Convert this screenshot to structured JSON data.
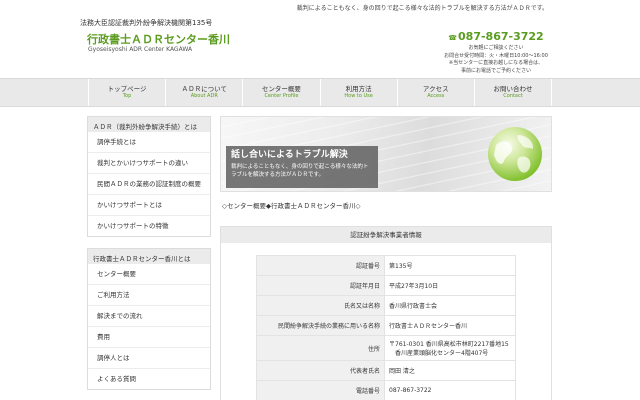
{
  "topbar": {
    "description": "裁判によることもなく、身の回りで起こる様々な法的トラブルを解決する方法がＡＤＲです。"
  },
  "header": {
    "certification": "法務大臣認証裁判外紛争解決機関第135号",
    "site_title": "行政書士ＡＤＲセンター香川",
    "site_subtitle": "Gyoseisyoshi ADR Center KAGAWA",
    "phone": "087-867-3722",
    "phone_icon": "phone-icon",
    "contact_lines": [
      "お気軽にご相談ください",
      "お問合せ受付時間：火・木曜日10:00～16:00",
      "※当センターに直接お越しになる場合は、",
      "事前にお電話でご予約ください"
    ]
  },
  "nav": {
    "items": [
      {
        "label": "トップページ",
        "sub": "Top"
      },
      {
        "label": "ＡＤＲについて",
        "sub": "About ADR"
      },
      {
        "label": "センター概要",
        "sub": "Center Profile"
      },
      {
        "label": "利用方法",
        "sub": "How to Use"
      },
      {
        "label": "アクセス",
        "sub": "Access"
      },
      {
        "label": "お問い合わせ",
        "sub": "Contact"
      }
    ]
  },
  "sidebar": {
    "section1": {
      "heading": "ＡＤＲ（裁判外紛争解決手続）とは",
      "items": [
        "調停手続とは",
        "裁判とかいけつサポートの違い",
        "民間ＡＤＲの業務の認証制度の概要",
        "かいけつサポートとは",
        "かいけつサポートの特徴"
      ]
    },
    "section2": {
      "heading": "行政書士ＡＤＲセンター香川とは",
      "items": [
        "センター概要",
        "ご利用方法",
        "解決までの流れ",
        "費用",
        "調停人とは",
        "よくある質問"
      ]
    }
  },
  "hero": {
    "title": "話し合いによるトラブル解決",
    "text": "裁判によることもなく、身の回りで起こる様々な法的トラブルを解決する方法がＡＤＲです。"
  },
  "breadcrumb": "◇センター概要◆行政書士ＡＤＲセンター香川◇",
  "info": {
    "heading": "認証紛争解決事業者情報",
    "rows": [
      {
        "label": "認証番号",
        "value": "第135号"
      },
      {
        "label": "認証年月日",
        "value": "平成27年3月10日"
      },
      {
        "label": "氏名又は名称",
        "value": "香川県行政書士会"
      },
      {
        "label": "民間紛争解決手続の業務に用いる名称",
        "value": "行政書士ＡＤＲセンター香川"
      },
      {
        "label": "住所",
        "value": "〒761-0301 香川県高松市林町2217番地15",
        "value2": "香川産業頭脳化センター4階407号"
      },
      {
        "label": "代表者氏名",
        "value": "岡田 清之"
      },
      {
        "label": "電話番号",
        "value": "087-867-3722"
      }
    ]
  },
  "colors": {
    "accent_green": "#5a9c1f",
    "nav_bg": "#e9e9e9",
    "table_label_bg": "#f0f0f0"
  }
}
